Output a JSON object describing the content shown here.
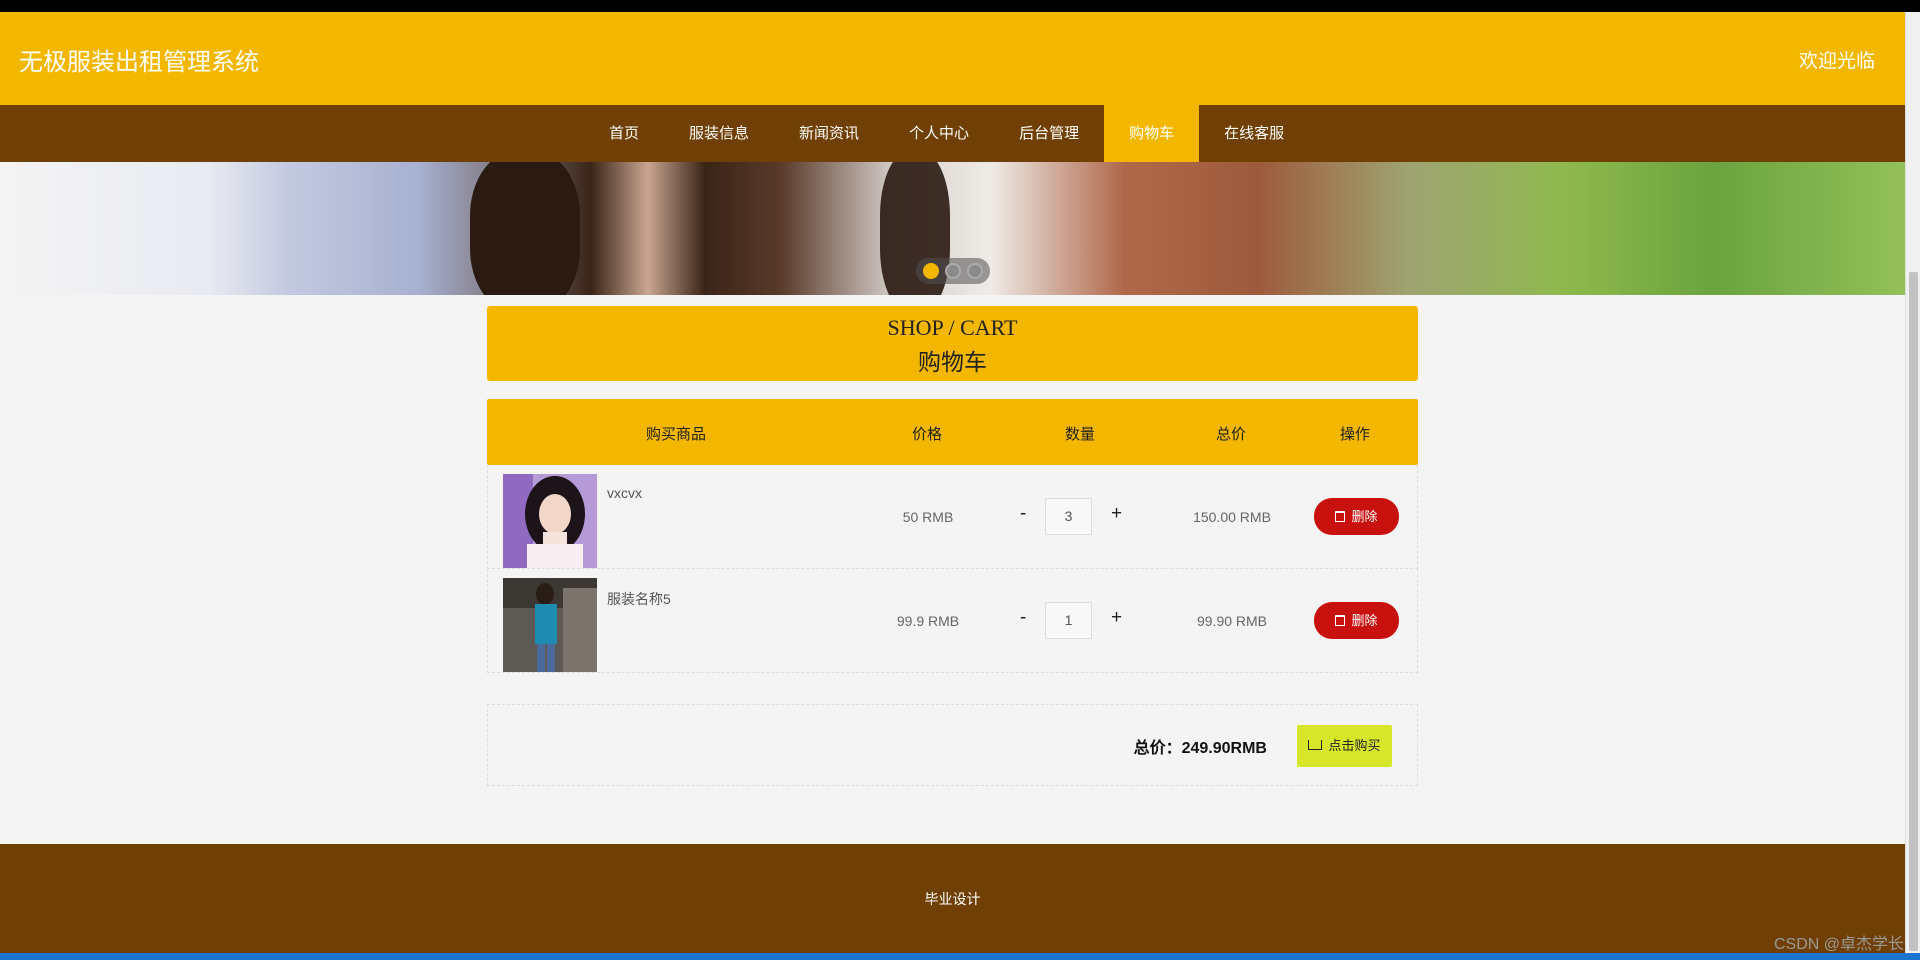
{
  "header": {
    "site_title": "无极服装出租管理系统",
    "welcome": "欢迎光临"
  },
  "nav": {
    "items": [
      {
        "label": "首页"
      },
      {
        "label": "服装信息"
      },
      {
        "label": "新闻资讯"
      },
      {
        "label": "个人中心"
      },
      {
        "label": "后台管理"
      },
      {
        "label": "购物车",
        "active": true
      },
      {
        "label": "在线客服"
      }
    ]
  },
  "banner": {
    "active_slide": 1,
    "slide_count": 3
  },
  "shop_title": {
    "en": "SHOP / CART",
    "cn": "购物车"
  },
  "cart": {
    "columns": [
      "购买商品",
      "价格",
      "数量",
      "总价",
      "操作"
    ],
    "rows": [
      {
        "name": "vxcvx",
        "price": "50 RMB",
        "minus": "-",
        "qty": "3",
        "plus": "+",
        "subtotal": "150.00 RMB",
        "delete_label": "删除"
      },
      {
        "name": "服装名称5",
        "price": "99.9 RMB",
        "minus": "-",
        "qty": "1",
        "plus": "+",
        "subtotal": "99.90 RMB",
        "delete_label": "删除"
      }
    ]
  },
  "total": {
    "label": "总价：249.90RMB",
    "buy_label": "点击购买"
  },
  "footer": {
    "text": "毕业设计"
  },
  "watermark": "CSDN @卓杰学长",
  "colors": {
    "brand_yellow": "#f3b700",
    "brand_brown": "#703f04",
    "delete_red": "#c8100d",
    "buy_yellow_green": "#d8e62a"
  }
}
